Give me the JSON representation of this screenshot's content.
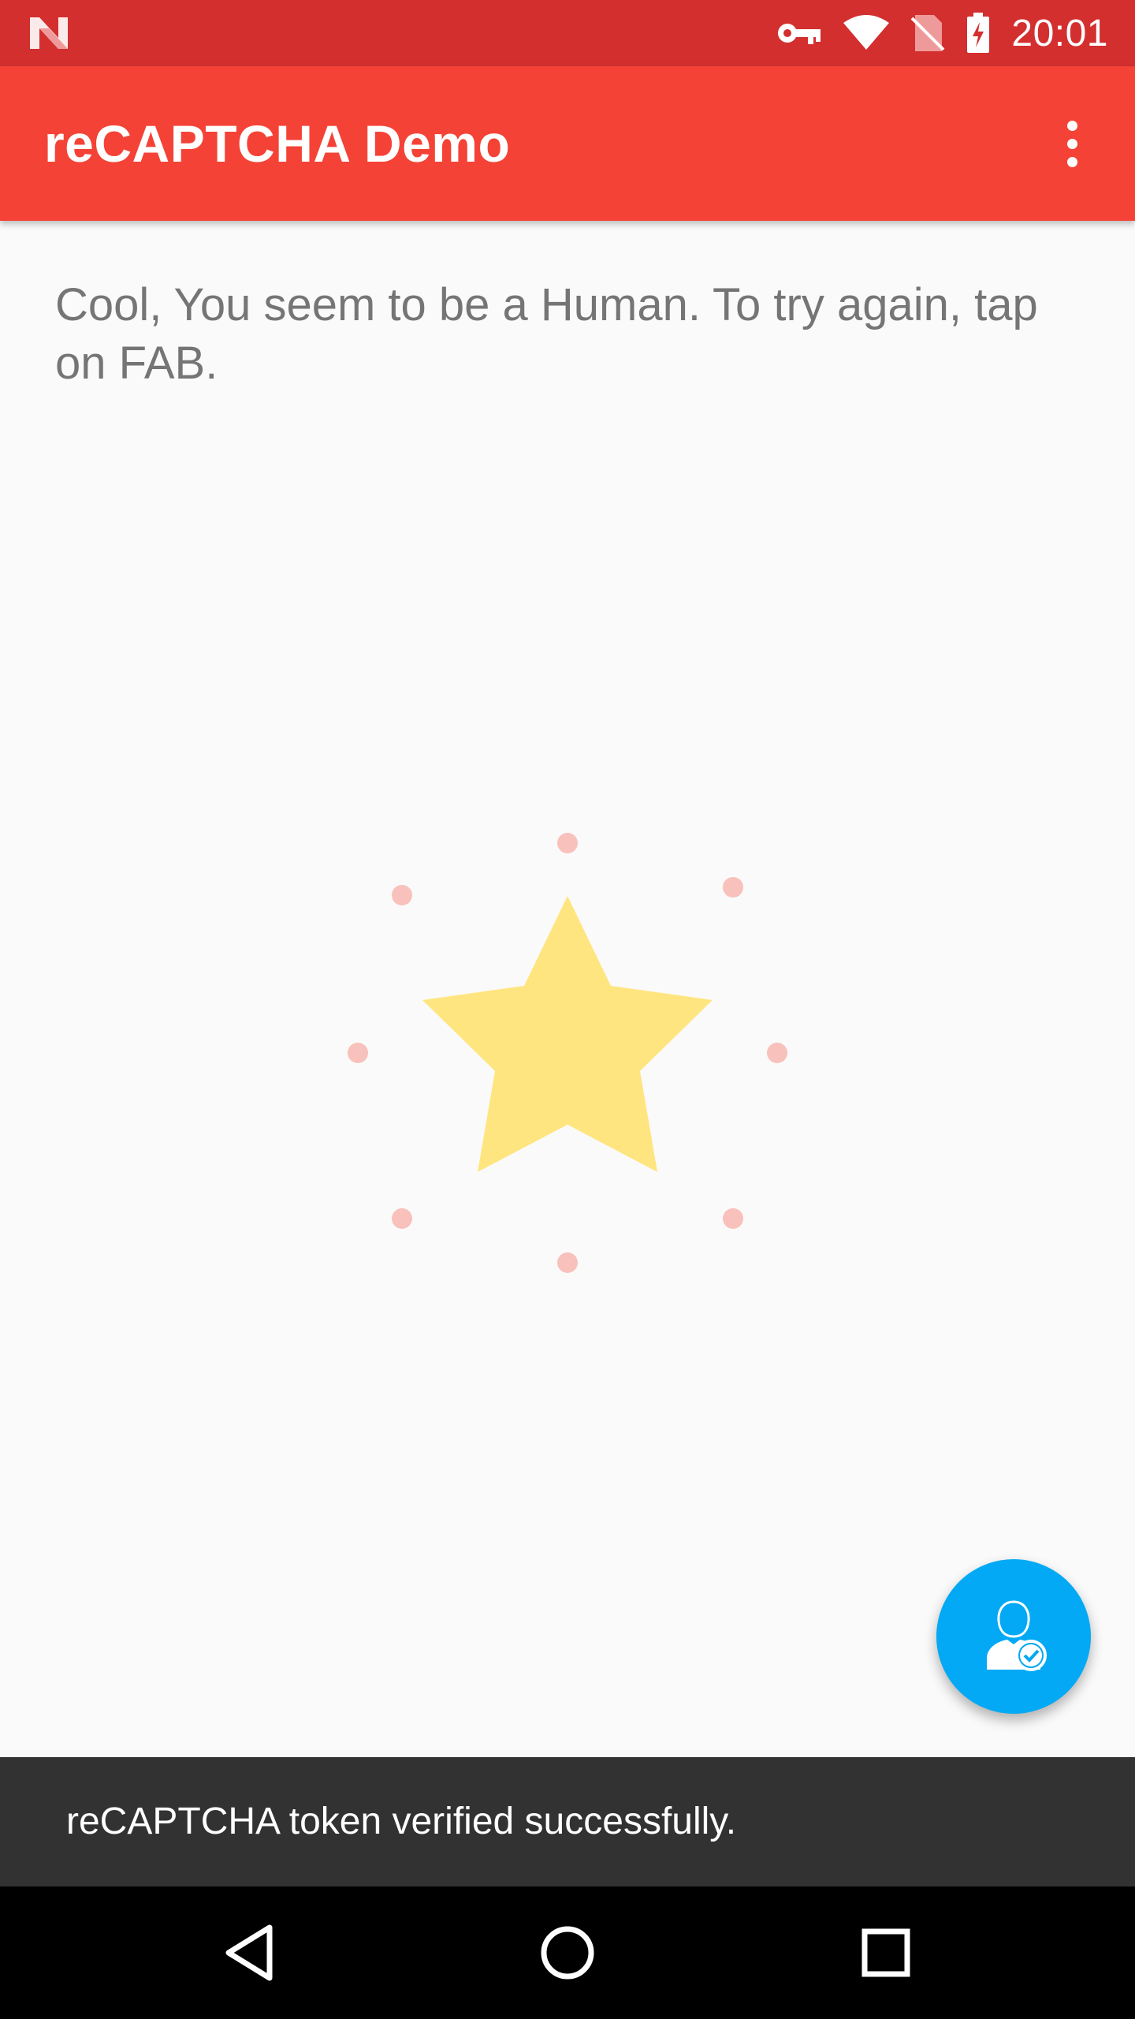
{
  "status_bar": {
    "time": "20:01",
    "icons": [
      "notification-n-icon",
      "vpn-key-icon",
      "wifi-icon",
      "no-sim-icon",
      "battery-charging-icon"
    ],
    "color": "#d32f2f"
  },
  "app_bar": {
    "title": "reCAPTCHA Demo",
    "color": "#f44336",
    "overflow_icon": "more-vert-icon"
  },
  "main": {
    "message": "Cool, You seem to be a Human. To try again, tap on FAB.",
    "illustration": "star-icon",
    "star_color": "#ffe57f",
    "dot_color": "#f8c1bb"
  },
  "fab": {
    "icon": "verified-user-icon",
    "color": "#03a9f4"
  },
  "snackbar": {
    "text": "reCAPTCHA token verified successfully."
  },
  "nav_bar": {
    "buttons": [
      "back-icon",
      "home-icon",
      "recents-icon"
    ]
  }
}
